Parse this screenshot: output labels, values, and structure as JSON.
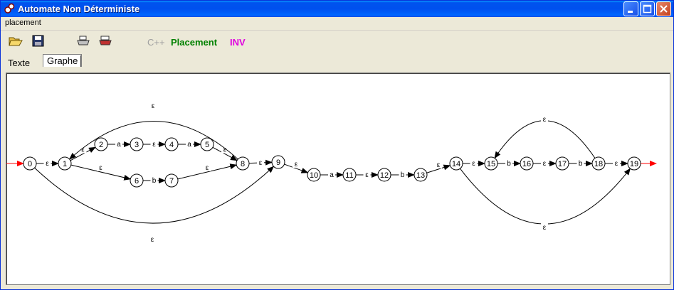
{
  "window": {
    "title": "Automate Non Déterministe"
  },
  "menu": {
    "items": [
      "placement"
    ]
  },
  "toolbar": {
    "cpp_label": "C++",
    "placement_label": "Placement",
    "inv_label": "INV",
    "colors": {
      "cpp": "#a0a0a0",
      "placement": "#008000",
      "inv": "#e000e0"
    }
  },
  "tabs": [
    "Texte",
    "Graphe"
  ],
  "active_tab": "Graphe",
  "graph": {
    "epsilon": "ε",
    "accent": "#ff0000",
    "states": [
      "0",
      "1",
      "2",
      "3",
      "4",
      "5",
      "6",
      "7",
      "8",
      "9",
      "10",
      "11",
      "12",
      "13",
      "14",
      "15",
      "16",
      "17",
      "18",
      "19"
    ],
    "initial": "0",
    "final": "19",
    "transitions": [
      {
        "from": "0",
        "to": "1",
        "label": "ε"
      },
      {
        "from": "1",
        "to": "2",
        "label": "ε"
      },
      {
        "from": "2",
        "to": "3",
        "label": "a"
      },
      {
        "from": "3",
        "to": "4",
        "label": "ε"
      },
      {
        "from": "4",
        "to": "5",
        "label": "a"
      },
      {
        "from": "5",
        "to": "8",
        "label": "ε"
      },
      {
        "from": "1",
        "to": "6",
        "label": "ε"
      },
      {
        "from": "6",
        "to": "7",
        "label": "b"
      },
      {
        "from": "7",
        "to": "8",
        "label": "ε"
      },
      {
        "from": "8",
        "to": "1",
        "label": "ε"
      },
      {
        "from": "0",
        "to": "9",
        "label": "ε"
      },
      {
        "from": "8",
        "to": "9",
        "label": "ε"
      },
      {
        "from": "9",
        "to": "10",
        "label": "ε"
      },
      {
        "from": "10",
        "to": "11",
        "label": "a"
      },
      {
        "from": "11",
        "to": "12",
        "label": "ε"
      },
      {
        "from": "12",
        "to": "13",
        "label": "b"
      },
      {
        "from": "13",
        "to": "14",
        "label": "ε"
      },
      {
        "from": "14",
        "to": "15",
        "label": "ε"
      },
      {
        "from": "15",
        "to": "16",
        "label": "b"
      },
      {
        "from": "16",
        "to": "17",
        "label": "ε"
      },
      {
        "from": "17",
        "to": "18",
        "label": "b"
      },
      {
        "from": "18",
        "to": "15",
        "label": "ε"
      },
      {
        "from": "18",
        "to": "19",
        "label": "ε"
      },
      {
        "from": "14",
        "to": "19",
        "label": "ε"
      }
    ]
  }
}
